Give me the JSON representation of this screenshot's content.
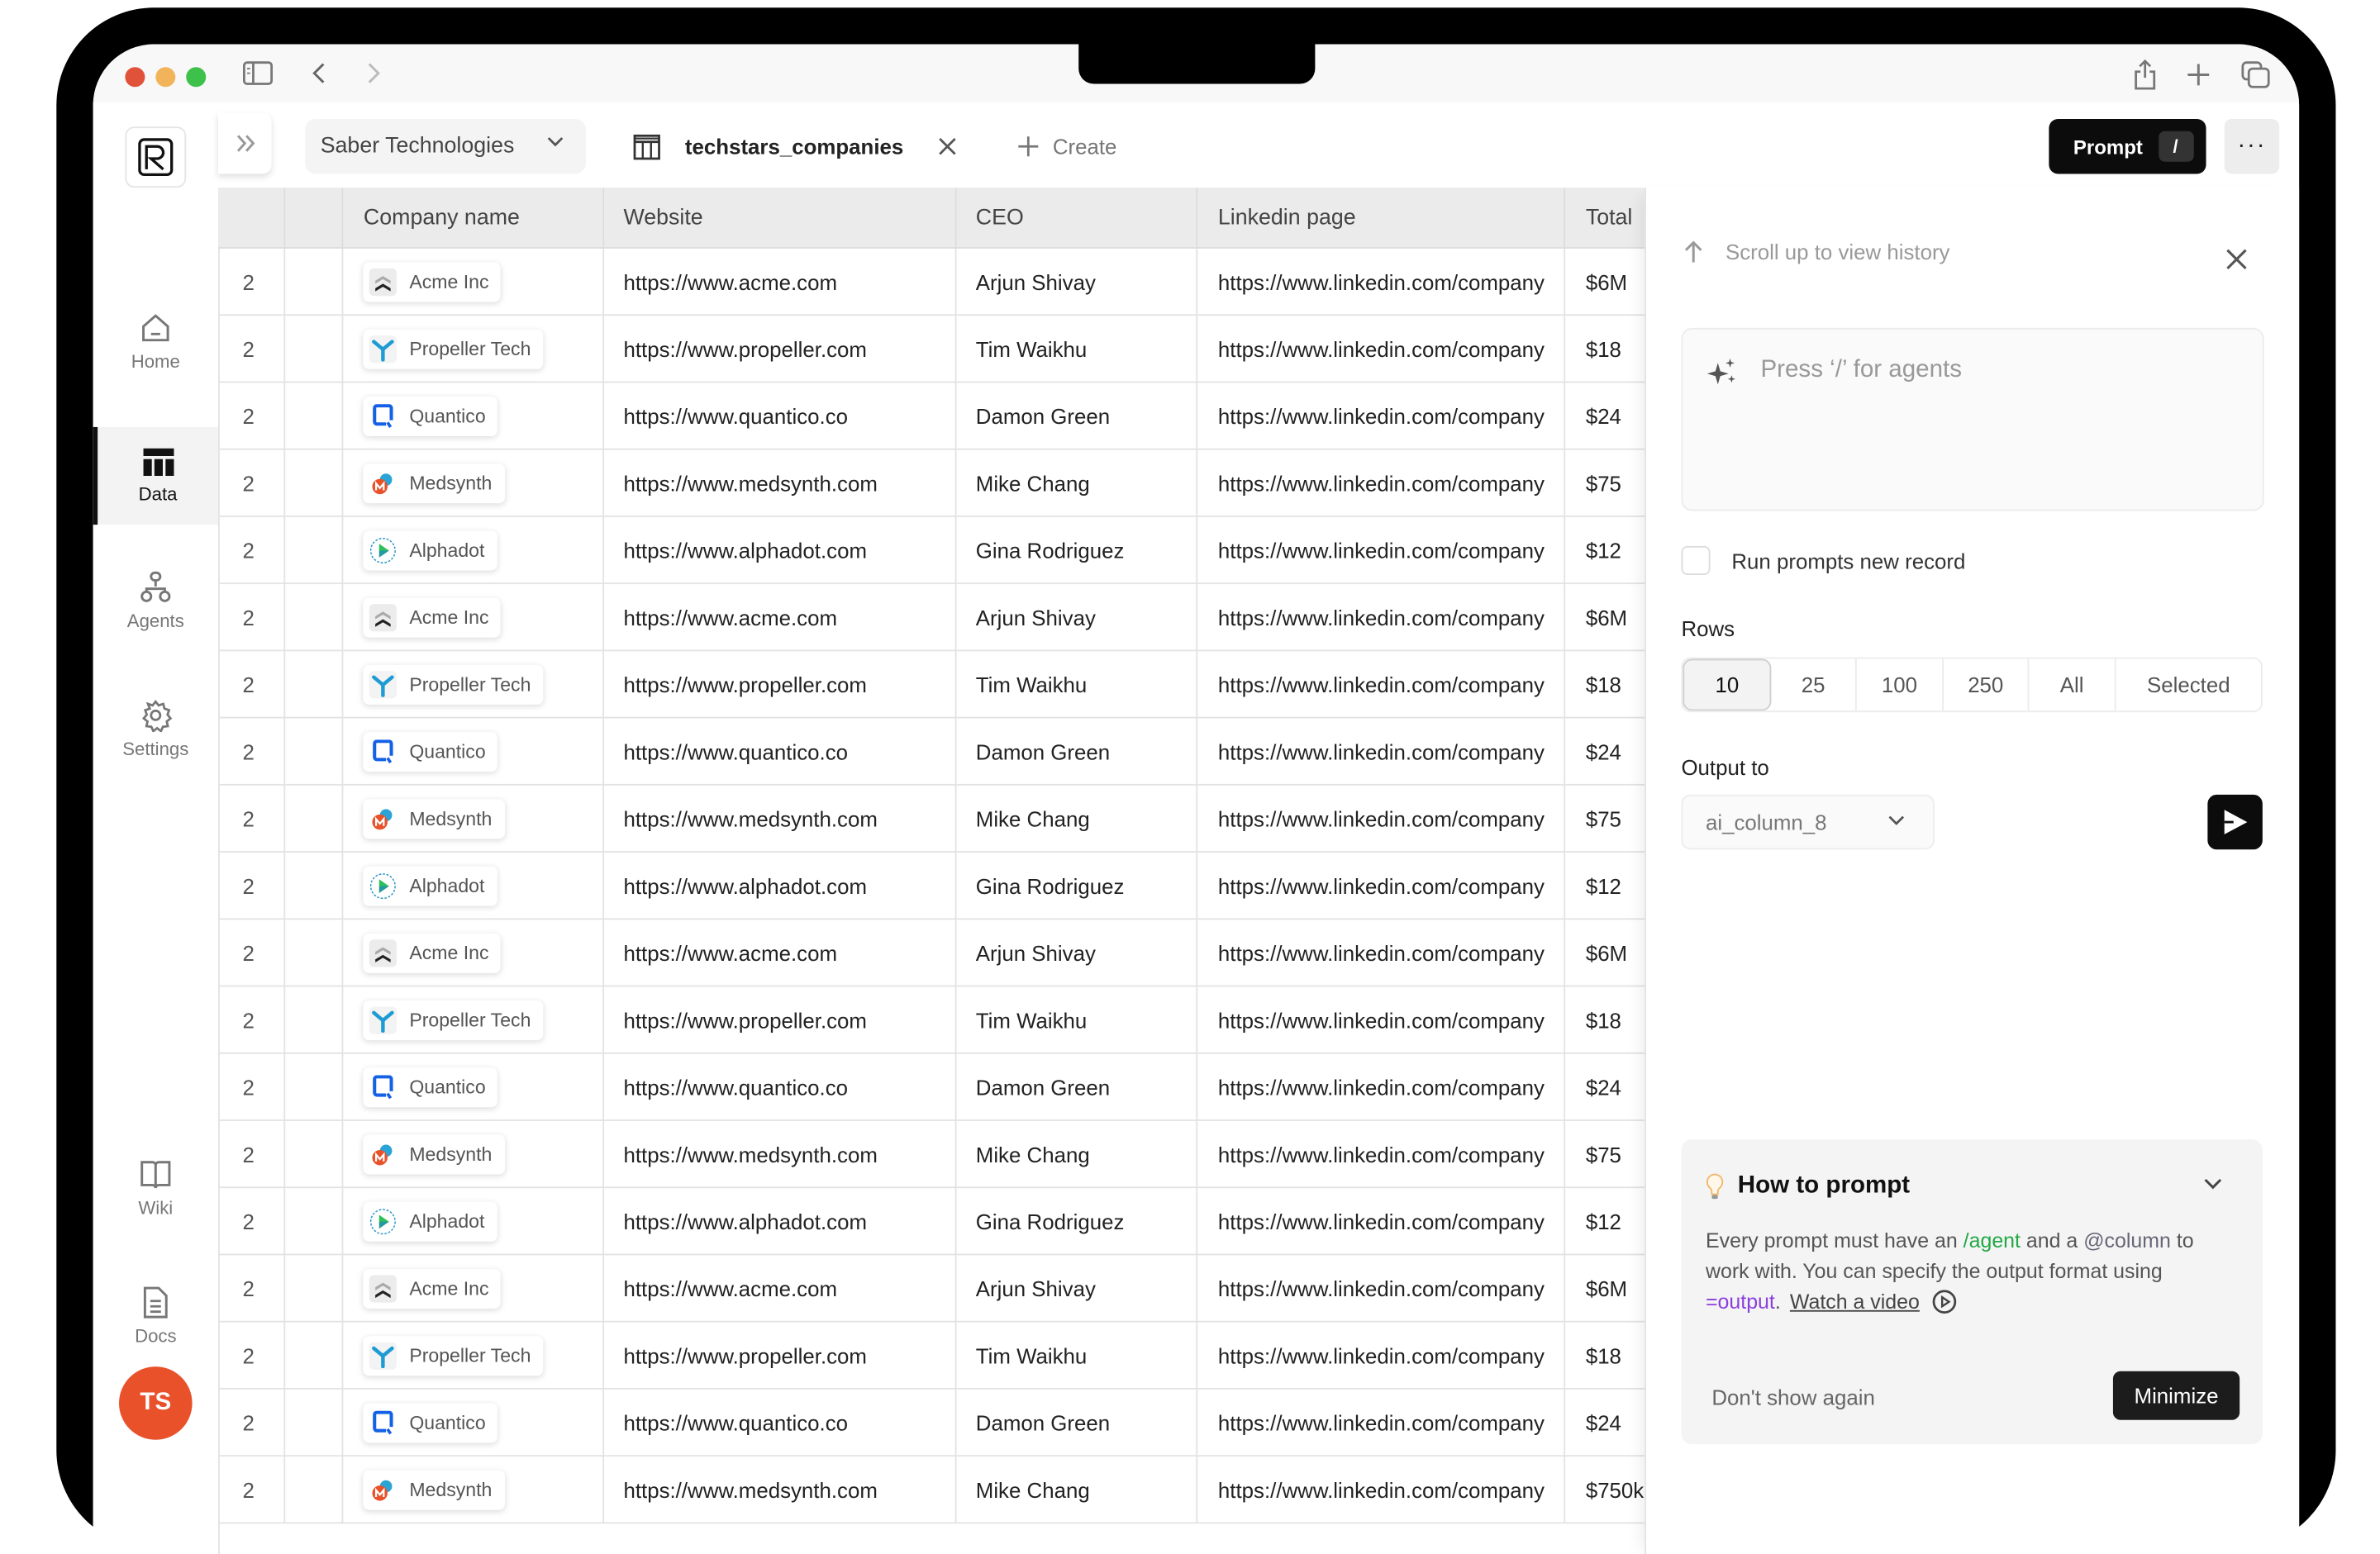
{
  "window": {
    "traffic_lights": {
      "close": "#e0533a",
      "minimize": "#f2b45b",
      "zoom": "#3ec14b"
    }
  },
  "sidebar": {
    "logo_letter": "R",
    "items": [
      {
        "label": "Home",
        "icon": "home-icon",
        "active": false
      },
      {
        "label": "Data",
        "icon": "table-icon",
        "active": true
      },
      {
        "label": "Agents",
        "icon": "agents-icon",
        "active": false
      },
      {
        "label": "Settings",
        "icon": "gear-icon",
        "active": false
      },
      {
        "label": "Wiki",
        "icon": "book-icon",
        "active": false
      },
      {
        "label": "Docs",
        "icon": "document-icon",
        "active": false
      }
    ],
    "avatar_initials": "TS",
    "avatar_color": "#e8512a"
  },
  "topbar": {
    "workspace": "Saber Technologies",
    "tab_label": "techstars_companies",
    "create_label": "Create",
    "prompt_label": "Prompt",
    "prompt_shortcut": "/",
    "more_label": "···"
  },
  "table": {
    "columns": [
      "",
      "",
      "Company name",
      "Website",
      "CEO",
      "Linkedin page",
      "Total"
    ],
    "rows": [
      {
        "num": "2",
        "company": "Acme Inc",
        "logo": "acme",
        "website": "https://www.acme.com",
        "ceo": "Arjun Shivay",
        "linkedin": "https://www.linkedin.com/company",
        "total": "$6M"
      },
      {
        "num": "2",
        "company": "Propeller Tech",
        "logo": "propeller",
        "website": "https://www.propeller.com",
        "ceo": "Tim Waikhu",
        "linkedin": "https://www.linkedin.com/company",
        "total": "$18"
      },
      {
        "num": "2",
        "company": "Quantico",
        "logo": "quantico",
        "website": "https://www.quantico.co",
        "ceo": "Damon Green",
        "linkedin": "https://www.linkedin.com/company",
        "total": "$24"
      },
      {
        "num": "2",
        "company": "Medsynth",
        "logo": "medsynth",
        "website": "https://www.medsynth.com",
        "ceo": "Mike Chang",
        "linkedin": "https://www.linkedin.com/company",
        "total": "$75"
      },
      {
        "num": "2",
        "company": "Alphadot",
        "logo": "alphadot",
        "website": "https://www.alphadot.com",
        "ceo": "Gina Rodriguez",
        "linkedin": "https://www.linkedin.com/company",
        "total": "$12"
      },
      {
        "num": "2",
        "company": "Acme Inc",
        "logo": "acme",
        "website": "https://www.acme.com",
        "ceo": "Arjun Shivay",
        "linkedin": "https://www.linkedin.com/company",
        "total": "$6M"
      },
      {
        "num": "2",
        "company": "Propeller Tech",
        "logo": "propeller",
        "website": "https://www.propeller.com",
        "ceo": "Tim Waikhu",
        "linkedin": "https://www.linkedin.com/company",
        "total": "$18"
      },
      {
        "num": "2",
        "company": "Quantico",
        "logo": "quantico",
        "website": "https://www.quantico.co",
        "ceo": "Damon Green",
        "linkedin": "https://www.linkedin.com/company",
        "total": "$24"
      },
      {
        "num": "2",
        "company": "Medsynth",
        "logo": "medsynth",
        "website": "https://www.medsynth.com",
        "ceo": "Mike Chang",
        "linkedin": "https://www.linkedin.com/company",
        "total": "$75"
      },
      {
        "num": "2",
        "company": "Alphadot",
        "logo": "alphadot",
        "website": "https://www.alphadot.com",
        "ceo": "Gina Rodriguez",
        "linkedin": "https://www.linkedin.com/company",
        "total": "$12"
      },
      {
        "num": "2",
        "company": "Acme Inc",
        "logo": "acme",
        "website": "https://www.acme.com",
        "ceo": "Arjun Shivay",
        "linkedin": "https://www.linkedin.com/company",
        "total": "$6M"
      },
      {
        "num": "2",
        "company": "Propeller Tech",
        "logo": "propeller",
        "website": "https://www.propeller.com",
        "ceo": "Tim Waikhu",
        "linkedin": "https://www.linkedin.com/company",
        "total": "$18"
      },
      {
        "num": "2",
        "company": "Quantico",
        "logo": "quantico",
        "website": "https://www.quantico.co",
        "ceo": "Damon Green",
        "linkedin": "https://www.linkedin.com/company",
        "total": "$24"
      },
      {
        "num": "2",
        "company": "Medsynth",
        "logo": "medsynth",
        "website": "https://www.medsynth.com",
        "ceo": "Mike Chang",
        "linkedin": "https://www.linkedin.com/company",
        "total": "$75"
      },
      {
        "num": "2",
        "company": "Alphadot",
        "logo": "alphadot",
        "website": "https://www.alphadot.com",
        "ceo": "Gina Rodriguez",
        "linkedin": "https://www.linkedin.com/company",
        "total": "$12"
      },
      {
        "num": "2",
        "company": "Acme Inc",
        "logo": "acme",
        "website": "https://www.acme.com",
        "ceo": "Arjun Shivay",
        "linkedin": "https://www.linkedin.com/company",
        "total": "$6M"
      },
      {
        "num": "2",
        "company": "Propeller Tech",
        "logo": "propeller",
        "website": "https://www.propeller.com",
        "ceo": "Tim Waikhu",
        "linkedin": "https://www.linkedin.com/company",
        "total": "$18"
      },
      {
        "num": "2",
        "company": "Quantico",
        "logo": "quantico",
        "website": "https://www.quantico.co",
        "ceo": "Damon Green",
        "linkedin": "https://www.linkedin.com/company",
        "total": "$24"
      },
      {
        "num": "2",
        "company": "Medsynth",
        "logo": "medsynth",
        "website": "https://www.medsynth.com",
        "ceo": "Mike Chang",
        "linkedin": "https://www.linkedin.com/company",
        "total": "$750k"
      }
    ]
  },
  "panel": {
    "history_label": "Scroll up to view history",
    "prompt_placeholder": "Press ‘/’ for agents",
    "run_prompts_label": "Run prompts new record",
    "run_prompts_checked": false,
    "rows_label": "Rows",
    "rows_options": [
      "10",
      "25",
      "100",
      "250",
      "All",
      "Selected"
    ],
    "rows_selected": "10",
    "output_label": "Output to",
    "output_value": "ai_column_8",
    "howto": {
      "title": "How to prompt",
      "body_1": "Every prompt must have an ",
      "agent_kw": "/agent",
      "body_2": " and a ",
      "column_kw": "@column",
      "body_3": " to work with. You can specify the output format using ",
      "output_kw": "=output",
      "body_4": ".",
      "watch_label": "Watch a video",
      "dont_show_label": "Don't show again",
      "minimize_label": "Minimize",
      "colors": {
        "agent": "#22a845",
        "output": "#8b3fe0"
      }
    }
  }
}
